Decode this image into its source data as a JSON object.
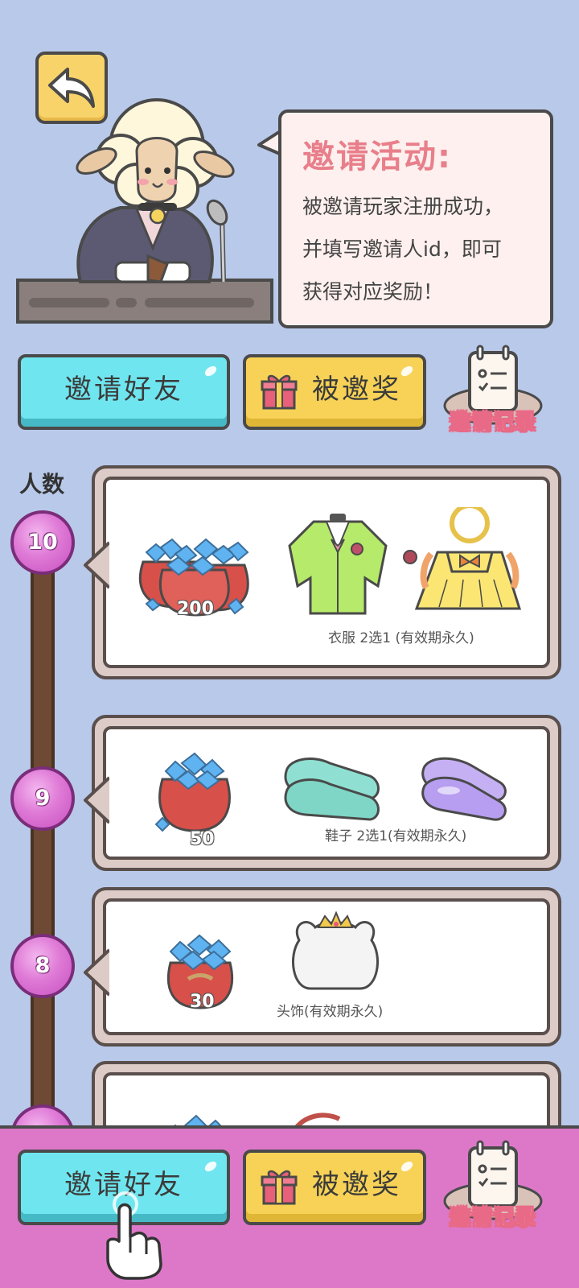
{
  "header": {
    "back_icon": "back-arrow-icon"
  },
  "announcement": {
    "title": "邀请活动:",
    "lines": [
      "被邀请玩家注册成功，",
      "并填写邀请人id，即可",
      "获得对应奖励！"
    ]
  },
  "actions": {
    "invite_label": "邀请好友",
    "reward_label": "被邀奖",
    "record_label": "邀请记录"
  },
  "timeline": {
    "count_label": "人数",
    "tiers": [
      {
        "count": "10",
        "gems": "200",
        "caption": "衣服 2选1 (有效期永久)"
      },
      {
        "count": "9",
        "gems": "50",
        "caption": "鞋子 2选1(有效期永久)"
      },
      {
        "count": "8",
        "gems": "30",
        "caption": "头饰(有效期永久)"
      },
      {
        "count": "",
        "gems": "",
        "caption": ""
      }
    ]
  },
  "bottom_actions": {
    "invite_label": "邀请好友",
    "reward_label": "被邀奖",
    "record_label": "邀请记录"
  },
  "colors": {
    "background": "#b9c9ea",
    "invite_button": "#6fe6ef",
    "reward_button": "#f7d256",
    "node": "#df7ad6",
    "bottom_bar": "#dd78c9",
    "bubble_title": "#e87f8b"
  }
}
